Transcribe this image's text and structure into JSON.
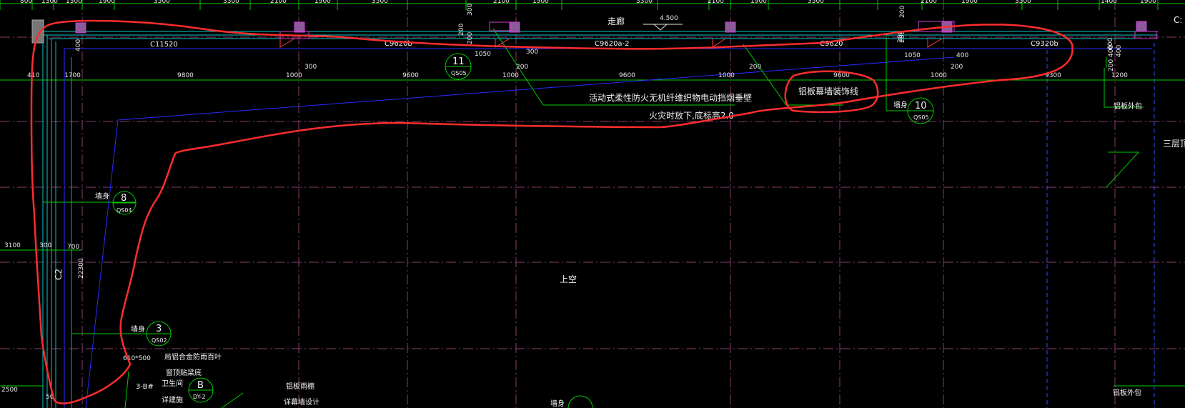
{
  "colors": {
    "background": "#000000",
    "dimension_line": "#00cc00",
    "wall_line": "#00c8c8",
    "axis_line": "#8a3c6e",
    "blue_line": "#2a2aff",
    "column": "#8a5a9a",
    "annotation_markup": "#ff3b3b",
    "text": "#f2f2f2"
  },
  "top_dimensions": [
    "800",
    "1300",
    "1300",
    "1900",
    "3500",
    "3300",
    "2100",
    "1900",
    "3500",
    "2100",
    "1900",
    "3300",
    "2100",
    "1900",
    "3500",
    "2100",
    "1900",
    "3500",
    "1400",
    "1900"
  ],
  "corridor": {
    "label": "走廊",
    "elevation": "4.500"
  },
  "window_tags": [
    "C11520",
    "C9620b",
    "C9620a-2",
    "C9620",
    "C9320b"
  ],
  "second_dimensions": [
    "410",
    "1700",
    "9800",
    "1000",
    "9600",
    "1000",
    "9600",
    "1000",
    "9600",
    "1000",
    "9300",
    "1200"
  ],
  "small_dimensions": [
    "300",
    "400",
    "200",
    "300",
    "200",
    "1050",
    "300",
    "200",
    "200",
    "200",
    "200",
    "1050",
    "400",
    "200",
    "400",
    "200",
    "600",
    "400",
    "200"
  ],
  "callouts": [
    {
      "label": "墙身",
      "number": "8",
      "code": "QS04"
    },
    {
      "label": "",
      "number": "11",
      "code": "QS05"
    },
    {
      "label": "墙身",
      "number": "10",
      "code": "QS05"
    },
    {
      "label": "墙身",
      "number": "3",
      "code": "QS02"
    },
    {
      "label": "卫生间",
      "number": "B",
      "code": "DY-2"
    }
  ],
  "notes": {
    "smoke_barrier_1": "活动式柔性防火无机纤维织物电动挡烟垂壁",
    "smoke_barrier_2": "火灾时放下,底标高2.0",
    "aluminum_line": "铝板幕墙装饰线",
    "aluminum_cladding_1": "铝板外包",
    "aluminum_cladding_2": "铝板外包",
    "third_floor": "三层顶",
    "void": "上空",
    "louver": "局铝合金防雨百叶",
    "louver_size": "610*500",
    "beam_bottom": "窗顶贴梁底",
    "axis_ref": "3-B#",
    "detail_ref": "详建施",
    "canopy": "铝板雨棚",
    "curtain": "详幕墙设计",
    "wall_partial": "墙身",
    "corner_label": "C:"
  },
  "left_dimensions": [
    "3100",
    "300",
    "700",
    "22300",
    "2500",
    "50"
  ],
  "column_label": "C2"
}
